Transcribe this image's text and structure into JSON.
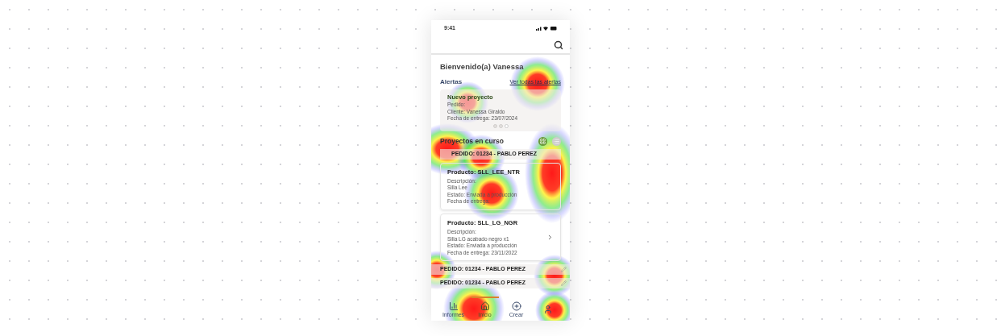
{
  "status_bar": {
    "time": "9:41"
  },
  "greeting": "Bienvenido(a) Vanessa",
  "alerts": {
    "title": "Alertas",
    "link": "Ver todas las alertas",
    "card": {
      "title": "Nuevo proyecto",
      "lines": [
        "Pedido:",
        "Cliente: Vanessa Giraldo",
        "Fecha de entrega: 23/07/2024"
      ]
    },
    "dots": [
      {
        "selected": false
      },
      {
        "selected": false
      },
      {
        "selected": true
      }
    ]
  },
  "projects": {
    "title": "Proyectos en curso",
    "header": "PEDIDO: 01234 - PABLO PEREZ",
    "products": [
      {
        "title": "Producto: SLL_LEE_NTR",
        "lines": [
          "Descripción:",
          "Silla Lee",
          "Estado: Enviada a producción",
          "Fecha de entrega:"
        ],
        "chevron": false
      },
      {
        "title": "Producto: SLL_LG_NGR",
        "lines": [
          "Descripción:",
          "Silla LG acabado negro x1",
          "Estado: Enviada a producción",
          "Fecha de entrega: 23/11/2022"
        ],
        "chevron": true
      }
    ],
    "orders": [
      "PEDIDO: 01234 - PABLO PEREZ",
      "PEDIDO: 01234 - PABLO PEREZ"
    ]
  },
  "nav": [
    {
      "kind": "chart",
      "label": "Informes",
      "selected": false
    },
    {
      "kind": "home",
      "label": "Inicio",
      "selected": true
    },
    {
      "kind": "plus",
      "label": "Crear",
      "selected": false
    },
    {
      "kind": "user",
      "selected": false
    }
  ]
}
